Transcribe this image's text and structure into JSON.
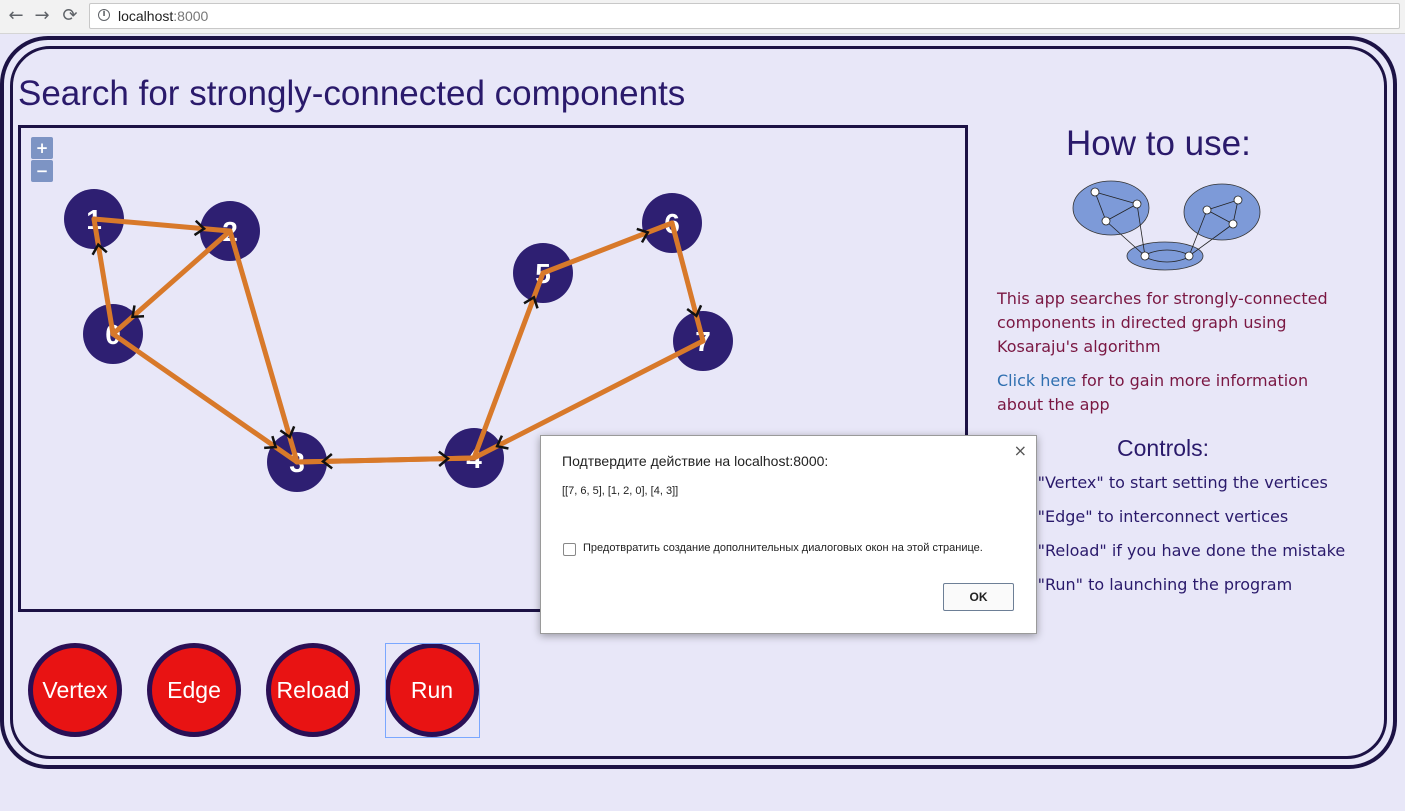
{
  "browser": {
    "url_host": "localhost",
    "url_port": ":8000",
    "back_icon": "arrow-left-icon",
    "forward_icon": "arrow-right-icon",
    "reload_icon": "reload-icon",
    "info_icon": "info-icon"
  },
  "page": {
    "title": "Search for strongly-connected components"
  },
  "zoom": {
    "plus": "+",
    "minus": "−"
  },
  "graph": {
    "vertices": [
      {
        "id": "1",
        "label": "1"
      },
      {
        "id": "2",
        "label": "2"
      },
      {
        "id": "0",
        "label": "0"
      },
      {
        "id": "3",
        "label": "3"
      },
      {
        "id": "4",
        "label": "4"
      },
      {
        "id": "5",
        "label": "5"
      },
      {
        "id": "6",
        "label": "6"
      },
      {
        "id": "7",
        "label": "7"
      }
    ],
    "edges": [
      {
        "from": "1",
        "to": "2"
      },
      {
        "from": "2",
        "to": "0"
      },
      {
        "from": "0",
        "to": "1"
      },
      {
        "from": "2",
        "to": "3"
      },
      {
        "from": "0",
        "to": "3"
      },
      {
        "from": "3",
        "to": "4"
      },
      {
        "from": "4",
        "to": "3"
      },
      {
        "from": "4",
        "to": "5"
      },
      {
        "from": "5",
        "to": "6"
      },
      {
        "from": "6",
        "to": "7"
      },
      {
        "from": "7",
        "to": "4"
      }
    ],
    "colors": {
      "vertex": "#2e1f72",
      "edge": "#d8792a",
      "arrow": "#111111",
      "label": "#ffffff"
    }
  },
  "sidebar": {
    "title": "How to use:",
    "description": "This app searches for strongly-connected components in directed graph using Kosaraju's algorithm",
    "link_text": "Click here",
    "link_rest": " for to gain more information about the app",
    "controls_title": "Controls:",
    "controls": [
      "ick \"Vertex\" to start setting the vertices",
      "ick \"Edge\" to interconnect vertices",
      "ick \"Reload\" if you have done the mistake",
      "ick \"Run\" to launching the program"
    ]
  },
  "buttons": {
    "vertex": "Vertex",
    "edge": "Edge",
    "reload": "Reload",
    "run": "Run",
    "color": "#e81313"
  },
  "dialog": {
    "title": "Подтвердите действие на localhost:8000:",
    "message": "[[7, 6, 5], [1, 2, 0], [4, 3]]",
    "checkbox_label": "Предотвратить создание дополнительных диалоговых окон на этой странице.",
    "ok_label": "OK",
    "close_icon": "close-icon"
  }
}
